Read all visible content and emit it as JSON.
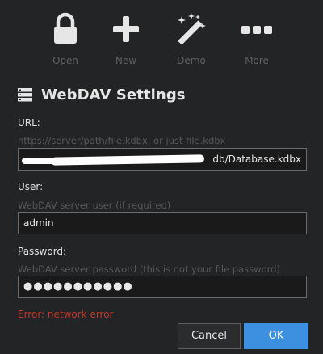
{
  "toolbar": {
    "items": [
      {
        "label": "Open",
        "icon": "lock-icon"
      },
      {
        "label": "New",
        "icon": "plus-icon"
      },
      {
        "label": "Demo",
        "icon": "magic-wand-icon"
      },
      {
        "label": "More",
        "icon": "ellipsis-icon"
      }
    ]
  },
  "dialog": {
    "title": "WebDAV Settings",
    "title_icon": "server-icon",
    "url": {
      "label": "URL:",
      "hint": "https://server/path/file.kdbx, or just file.kdbx",
      "value_visible": "db/Database.kdbx"
    },
    "user": {
      "label": "User:",
      "hint": "WebDAV server user (if required)",
      "value": "admin"
    },
    "password": {
      "label": "Password:",
      "hint": "WebDAV server password (this is not your file password)",
      "value_masked": "●●●●●●●●●●●"
    },
    "error": "Error: network error",
    "buttons": {
      "cancel": "Cancel",
      "ok": "OK"
    }
  },
  "colors": {
    "background": "#232425",
    "accent": "#3d8fe0",
    "error": "#c0392b",
    "muted": "#5e6064"
  }
}
